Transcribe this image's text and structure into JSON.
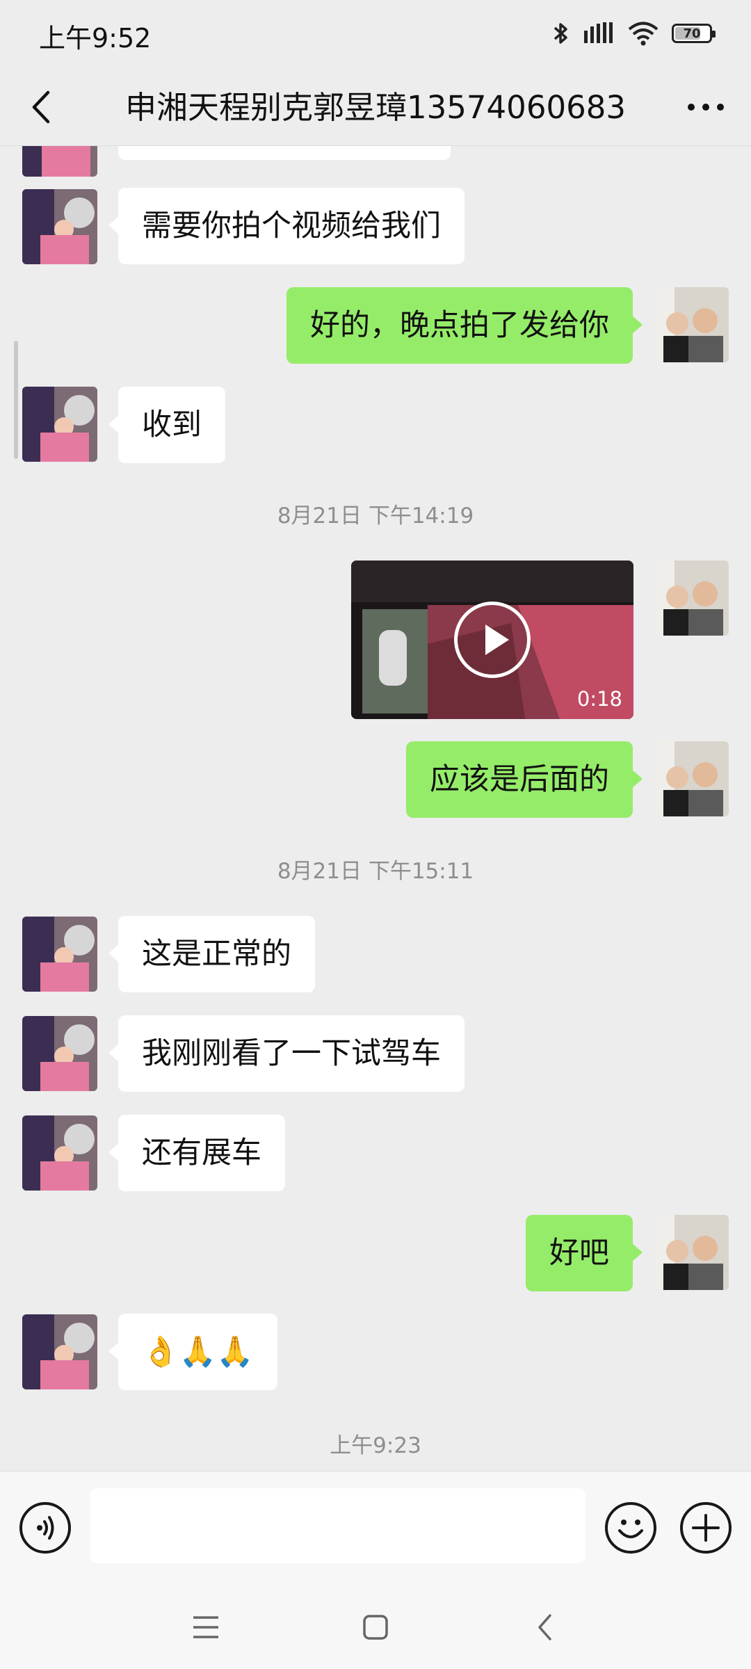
{
  "status_bar": {
    "time": "上午9:52",
    "battery": "70",
    "battery_level": 0.7
  },
  "header": {
    "title": "申湘天程别克郭昱璋13574060683"
  },
  "messages": [
    {
      "side": "in",
      "text": "需要你拍个视频给我们"
    },
    {
      "side": "out",
      "text": "好的，晚点拍了发给你"
    },
    {
      "side": "in",
      "text": "收到"
    },
    {
      "type": "timestamp",
      "text": "8月21日 下午14:19"
    },
    {
      "side": "out",
      "type": "video",
      "duration": "0:18"
    },
    {
      "side": "out",
      "text": "应该是后面的"
    },
    {
      "type": "timestamp",
      "text": "8月21日 下午15:11"
    },
    {
      "side": "in",
      "text": "这是正常的"
    },
    {
      "side": "in",
      "text": "我刚刚看了一下试驾车"
    },
    {
      "side": "in",
      "text": "还有展车"
    },
    {
      "side": "out",
      "text": "好吧"
    },
    {
      "side": "in",
      "text": "👌🙏🙏"
    },
    {
      "type": "timestamp",
      "text": "上午9:23"
    }
  ],
  "input_bar": {
    "value": "",
    "placeholder": ""
  },
  "colors": {
    "background": "#ededed",
    "outgoing_bubble": "#95ec69",
    "incoming_bubble": "#ffffff",
    "timestamp": "#8e8e8e"
  }
}
